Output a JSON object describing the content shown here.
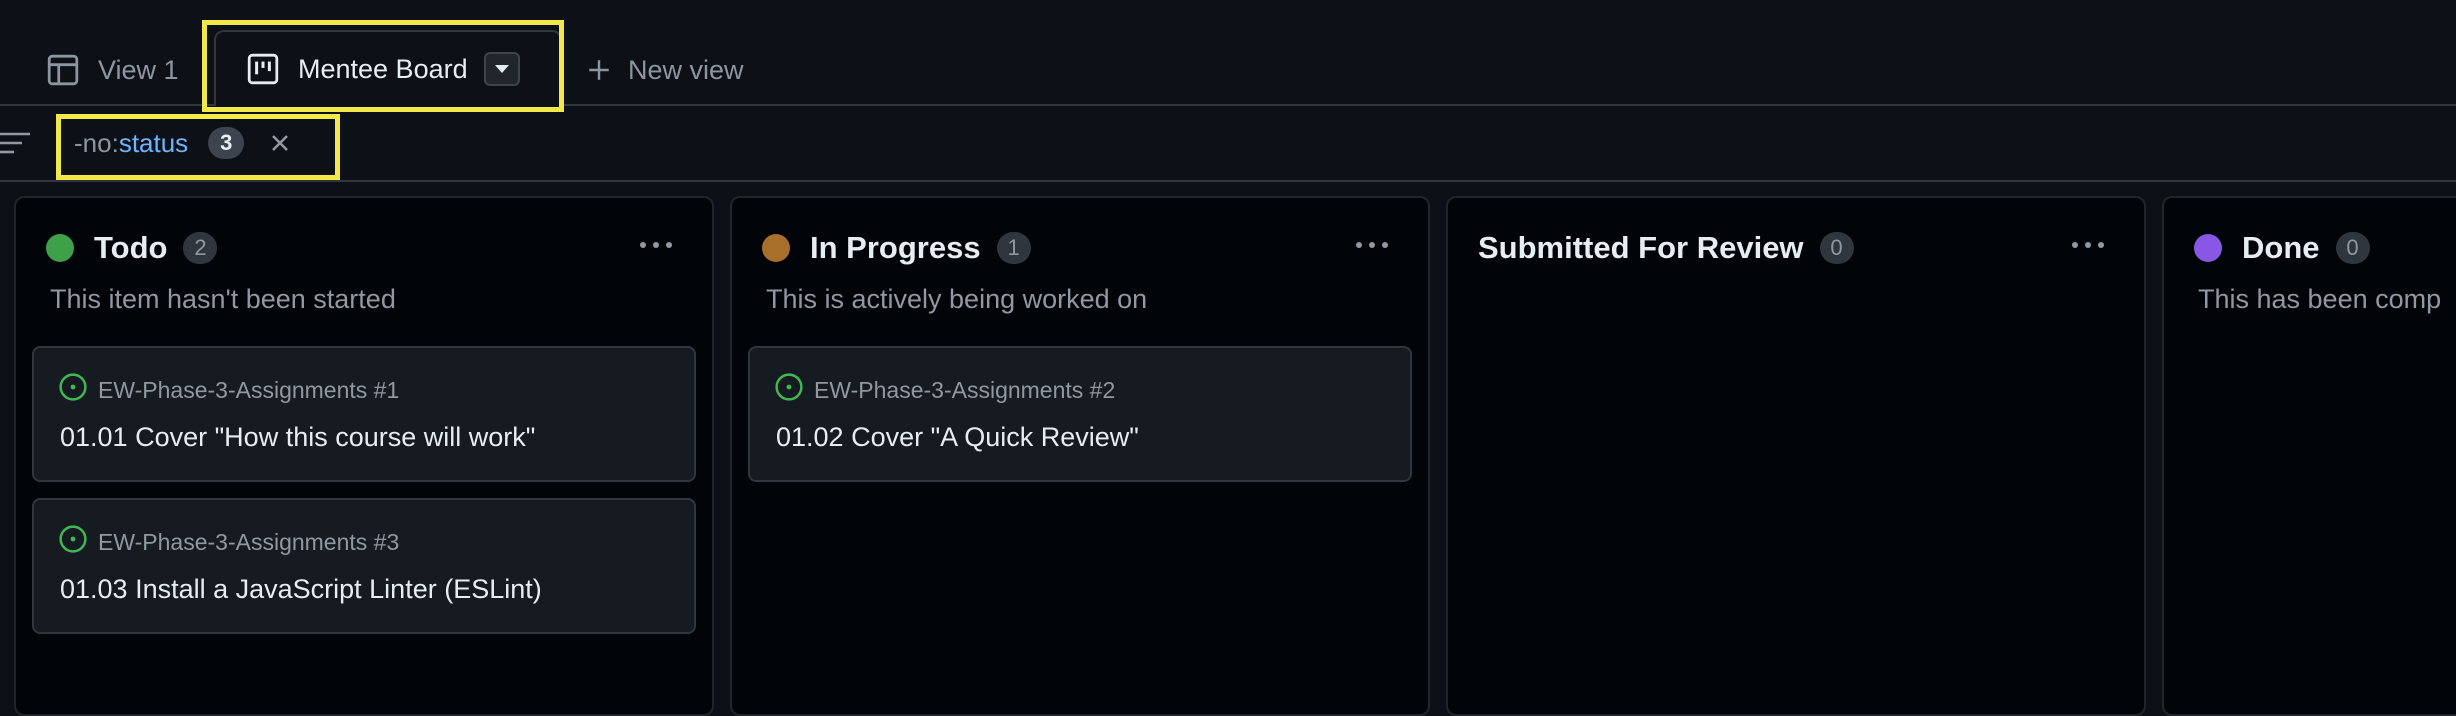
{
  "tabs": {
    "view1": {
      "label": "View 1",
      "icon": "table-icon"
    },
    "board": {
      "label": "Mentee Board",
      "icon": "board-icon",
      "menu_icon": "caret-down-icon"
    },
    "new_view": {
      "label": "New view",
      "icon": "plus-icon"
    }
  },
  "filter": {
    "icon": "filter-icon",
    "key": "-no:",
    "value": "status",
    "count": "3",
    "clear_icon": "x-icon"
  },
  "columns": [
    {
      "title": "Todo",
      "count": "2",
      "color": "#3fa04a",
      "description": "This item hasn't been started",
      "cards": [
        {
          "repo": "EW-Phase-3-Assignments #1",
          "title": "01.01 Cover \"How this course will work\""
        },
        {
          "repo": "EW-Phase-3-Assignments #3",
          "title": "01.03 Install a JavaScript Linter (ESLint)"
        }
      ]
    },
    {
      "title": "In Progress",
      "count": "1",
      "color": "#a86f2b",
      "description": "This is actively being worked on",
      "cards": [
        {
          "repo": "EW-Phase-3-Assignments #2",
          "title": "01.02 Cover \"A Quick Review\""
        }
      ]
    },
    {
      "title": "Submitted For Review",
      "count": "0",
      "color": null,
      "description": "",
      "cards": []
    },
    {
      "title": "Done",
      "count": "0",
      "color": "#8957e5",
      "description": "This has been comp",
      "cards": []
    }
  ],
  "colors": {
    "background": "#0d1117",
    "highlight": "#f2e84a",
    "open_issue": "#3fb950",
    "link": "#6cb6ff"
  }
}
